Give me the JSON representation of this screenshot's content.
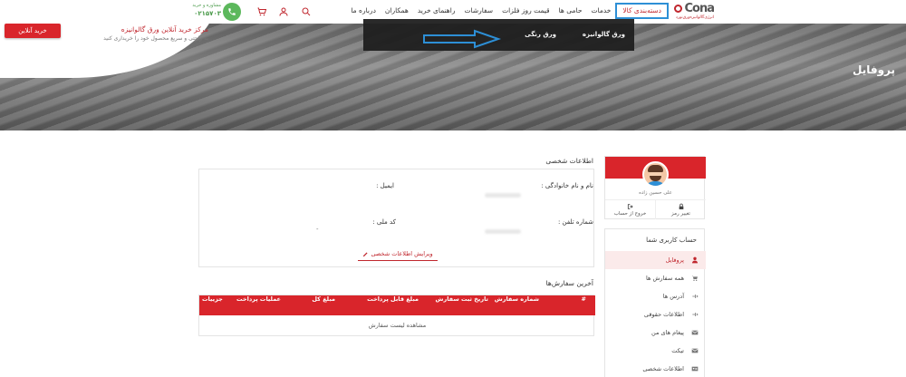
{
  "header": {
    "logo": {
      "text": "Cona",
      "subtitle": "انرژی‌گالوانیزه‌ورق‌نورد"
    },
    "nav": [
      {
        "label": "دسته‌بندی کالا",
        "active": true
      },
      {
        "label": "خدمات",
        "active": false
      },
      {
        "label": "حامی ها",
        "active": false
      },
      {
        "label": "قیمت روز فلزات",
        "active": false
      },
      {
        "label": "سفارشات",
        "active": false
      },
      {
        "label": "راهنمای خرید",
        "active": false
      },
      {
        "label": "همکاران",
        "active": false
      },
      {
        "label": "درباره ما",
        "active": false
      }
    ],
    "phone": {
      "label": "مشاوره و خرید",
      "number": "۰۲۱۵۷۰۳"
    },
    "icons": [
      "phone-icon",
      "cart-icon",
      "user-icon",
      "search-icon"
    ]
  },
  "hero": {
    "buy_button": "خرید آنلاین",
    "title": "مرکز خرید آنلاین ورق گالوانیزه",
    "subtitle": "به راحتی و سریع محصول خود را خریداری کنید",
    "page_title": "پروفایل"
  },
  "dropdown": {
    "items": [
      "ورق گالوانیزه",
      "ورق رنگی"
    ]
  },
  "profile": {
    "name": "علی حسین زاده",
    "actions": [
      {
        "label": "تغییر رمز",
        "icon": "lock-icon"
      },
      {
        "label": "خروج از حساب",
        "icon": "logout-icon"
      }
    ]
  },
  "menu": {
    "title": "حساب کاربری شما",
    "items": [
      {
        "label": "پروفایل",
        "icon": "user-icon",
        "active": true
      },
      {
        "label": "همه سفارش ها",
        "icon": "cart-icon",
        "active": false
      },
      {
        "label": "آدرس ها",
        "icon": "pin-icon",
        "active": false
      },
      {
        "label": "اطلاعات حقوقی",
        "icon": "pin-icon",
        "active": false
      },
      {
        "label": "پیغام های من",
        "icon": "mail-icon",
        "active": false
      },
      {
        "label": "تیکت",
        "icon": "mail-icon",
        "active": false
      },
      {
        "label": "اطلاعات شخصی",
        "icon": "id-card-icon",
        "active": false
      }
    ]
  },
  "personal_info": {
    "title": "اطلاعات شخصی",
    "fields": {
      "name_label": "نام و نام خانوادگی :",
      "email_label": "ایمیل :",
      "phone_label": "شماره تلفن :",
      "national_id_label": "کد ملی :",
      "national_id_value": "-"
    },
    "edit_label": "ویرایش اطلاعات شخصی"
  },
  "orders": {
    "title": "آخرین سفارش‌ها",
    "columns": [
      "#",
      "شماره سفارش",
      "تاریخ ثبت سفارش",
      "مبلغ قابل پرداخت",
      "مبلغ کل",
      "عملیات پرداخت",
      "جزییات"
    ],
    "empty_text": "مشاهده لیست سفارش"
  },
  "colors": {
    "primary_red": "#d9252b",
    "highlight_blue": "#2d8fd6",
    "phone_green": "#5cb85c"
  }
}
